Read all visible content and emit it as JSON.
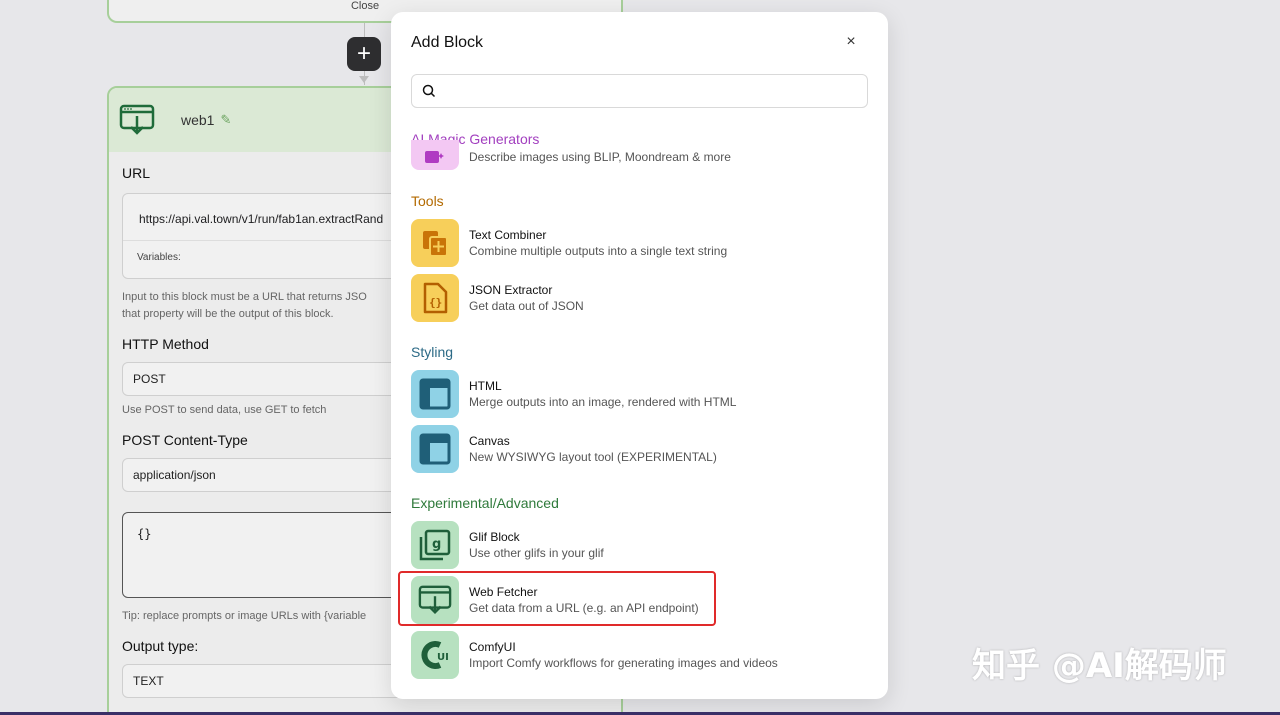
{
  "workspace": {
    "prev_card_label": "Close",
    "web_card": {
      "title": "web1",
      "url_label": "URL",
      "url_value": "https://api.val.town/v1/run/fab1an.extractRand",
      "variables_label": "Variables:",
      "input_hint_line1": "Input to this block must be a URL that returns JSO",
      "input_hint_line2": "that property will be the output of this block.",
      "http_method_label": "HTTP Method",
      "http_method_value": "POST",
      "http_method_hint": "Use POST to send data, use GET to fetch",
      "content_type_label": "POST Content-Type",
      "content_type_value": "application/json",
      "body_value": "{}",
      "tip": "Tip: replace prompts or image URLs with {variable",
      "output_type_label": "Output type:",
      "output_type_value": "TEXT"
    }
  },
  "modal": {
    "title": "Add Block",
    "close_glyph": "×",
    "search_placeholder": "",
    "sections": {
      "ai": {
        "title": "AI Magic Generators",
        "color": "#a23fbf",
        "items": [
          {
            "name": "",
            "desc": "Describe images using BLIP, Moondream & more"
          }
        ]
      },
      "tools": {
        "title": "Tools",
        "color": "#b36a00",
        "items": [
          {
            "name": "Text Combiner",
            "desc": "Combine multiple outputs into a single text string",
            "icon": "text-combiner-icon"
          },
          {
            "name": "JSON Extractor",
            "desc": "Get data out of JSON",
            "icon": "json-file-icon"
          }
        ]
      },
      "styling": {
        "title": "Styling",
        "color": "#2c6a86",
        "items": [
          {
            "name": "HTML",
            "desc": "Merge outputs into an image, rendered with HTML",
            "icon": "layout-icon"
          },
          {
            "name": "Canvas",
            "desc": "New WYSIWYG layout tool (EXPERIMENTAL)",
            "icon": "layout-icon"
          }
        ]
      },
      "experimental": {
        "title": "Experimental/Advanced",
        "color": "#2f7a3b",
        "items": [
          {
            "name": "Glif Block",
            "desc": "Use other glifs in your glif",
            "icon": "glif-block-icon"
          },
          {
            "name": "Web Fetcher",
            "desc": "Get data from a URL (e.g. an API endpoint)",
            "icon": "web-fetcher-icon"
          },
          {
            "name": "ComfyUI",
            "desc": "Import Comfy workflows for generating images and videos",
            "icon": "comfyui-icon"
          }
        ]
      }
    }
  },
  "watermark": "知乎 @AI解码师"
}
